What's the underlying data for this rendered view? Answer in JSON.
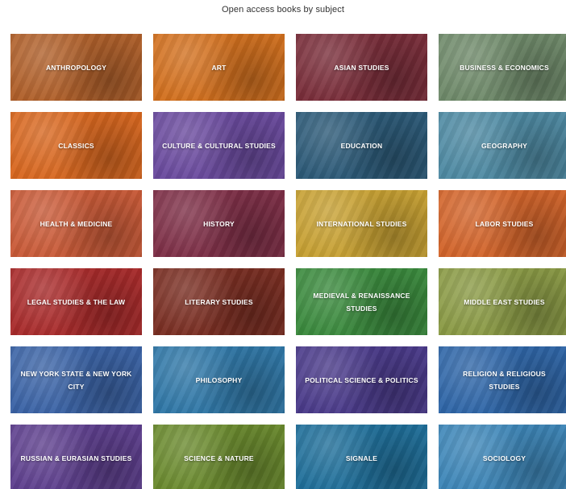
{
  "page": {
    "title": "Open access books by subject"
  },
  "subjects": [
    {
      "label": "ANTHROPOLOGY",
      "color": "#b0602a"
    },
    {
      "label": "ART",
      "color": "#d2701e"
    },
    {
      "label": "ASIAN STUDIES",
      "color": "#7a2e3a"
    },
    {
      "label": "BUSINESS & ECONOMICS",
      "color": "#6f8a6a"
    },
    {
      "label": "CLASSICS",
      "color": "#d8671f"
    },
    {
      "label": "CULTURE & CULTURAL STUDIES",
      "color": "#6a4a9e"
    },
    {
      "label": "EDUCATION",
      "color": "#2c5a78"
    },
    {
      "label": "GEOGRAPHY",
      "color": "#4e8aa3"
    },
    {
      "label": "HEALTH & MEDICINE",
      "color": "#c95a37"
    },
    {
      "label": "HISTORY",
      "color": "#7e2f47"
    },
    {
      "label": "INTERNATIONAL STUDIES",
      "color": "#c7a032"
    },
    {
      "label": "LABOR STUDIES",
      "color": "#d2642a"
    },
    {
      "label": "LEGAL STUDIES & THE LAW",
      "color": "#a92b2b"
    },
    {
      "label": "LITERARY STUDIES",
      "color": "#7a2e22"
    },
    {
      "label": "MEDIEVAL & RENAISSANCE STUDIES",
      "color": "#3a8a3d"
    },
    {
      "label": "MIDDLE EAST STUDIES",
      "color": "#8a9a45"
    },
    {
      "label": "NEW YORK STATE & NEW YORK CITY",
      "color": "#3a63a6"
    },
    {
      "label": "PHILOSOPHY",
      "color": "#3078a8"
    },
    {
      "label": "POLITICAL SCIENCE & POLITICS",
      "color": "#4a3a8a"
    },
    {
      "label": "RELIGION & RELIGIOUS STUDIES",
      "color": "#2f66a8"
    },
    {
      "label": "RUSSIAN & EURASIAN STUDIES",
      "color": "#5e3f8e"
    },
    {
      "label": "SCIENCE & NATURE",
      "color": "#6a8a2e"
    },
    {
      "label": "SIGNALE",
      "color": "#1f6f9a"
    },
    {
      "label": "SOCIOLOGY",
      "color": "#3d86b8"
    }
  ]
}
